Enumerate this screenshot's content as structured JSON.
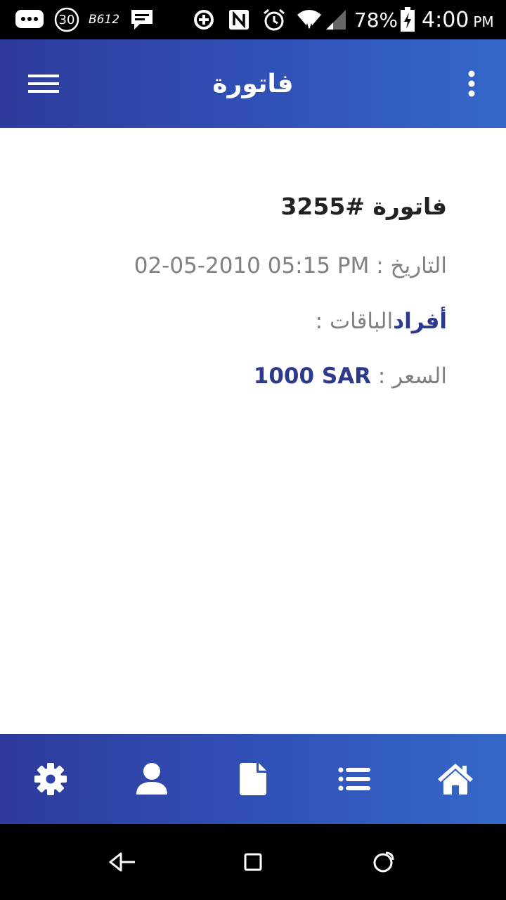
{
  "status_bar": {
    "notification_30": "30",
    "b612_label": "B612",
    "battery_percent": "78%",
    "time": "4:00",
    "time_suffix": "PM"
  },
  "app_bar": {
    "title": "فاتورة"
  },
  "invoice": {
    "heading": "فاتورة #3255",
    "date_label": "التاريخ : ",
    "date_value": "02-05-2010 05:15 PM",
    "package_label": "الباقات : ",
    "package_value": "أفراد",
    "price_label": "السعر : ",
    "price_value": "1000 SAR"
  },
  "bottom_nav": {
    "items": [
      "settings-icon",
      "user-icon",
      "document-icon",
      "list-icon",
      "home-icon"
    ]
  },
  "colors": {
    "primary_start": "#2e3a9c",
    "primary_end": "#3468c8",
    "value_blue": "#2d3a8c",
    "label_gray": "#808080"
  }
}
